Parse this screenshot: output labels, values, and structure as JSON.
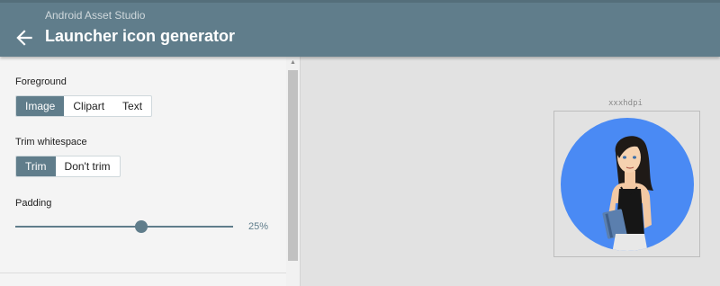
{
  "header": {
    "app_title": "Android Asset Studio",
    "page_title": "Launcher icon generator",
    "back_icon": "arrow-back-icon",
    "bar_color": "#607d8b"
  },
  "form": {
    "foreground": {
      "label": "Foreground",
      "options": [
        "Image",
        "Clipart",
        "Text"
      ],
      "selected": "Image"
    },
    "trim": {
      "label": "Trim whitespace",
      "options": [
        "Trim",
        "Don't trim"
      ],
      "selected": "Trim"
    },
    "padding": {
      "label": "Padding",
      "value": 25,
      "value_text": "25%"
    }
  },
  "preview": {
    "density": "xxxhdpi",
    "icon_shape": "circle",
    "icon_background": "#4285f4",
    "image_subject": "woman-holding-book-illustration"
  }
}
